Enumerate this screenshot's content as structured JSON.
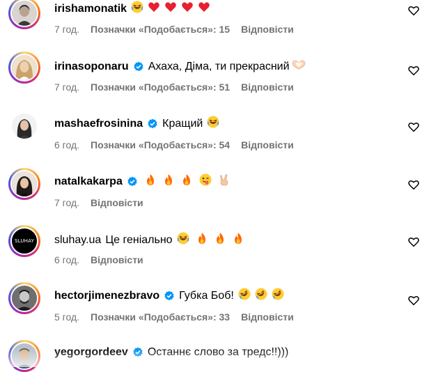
{
  "colors": {
    "verified_blue": "#0095f6",
    "meta_gray": "#737373",
    "heart_red": "#ff3040",
    "fire_orange": "#ff6a00"
  },
  "comments": [
    {
      "username": "irishamonatik",
      "verified": false,
      "text": "",
      "emojis": [
        "laughing-face",
        "red-heart",
        "red-heart",
        "red-heart",
        "red-heart"
      ],
      "time": "7 год.",
      "likes": "Позначки «Подобається»: 15",
      "reply": "Відповісти"
    },
    {
      "username": "irinasoponaru",
      "verified": true,
      "text": "Ахаха, Діма, ти прекрасний",
      "emojis": [
        "heart-hands"
      ],
      "time": "7 год.",
      "likes": "Позначки «Подобається»: 51",
      "reply": "Відповісти"
    },
    {
      "username": "mashaefrosinina",
      "verified": true,
      "text": "Кращий",
      "emojis": [
        "laughing-face"
      ],
      "time": "6 год.",
      "likes": "Позначки «Подобається»: 54",
      "reply": "Відповісти"
    },
    {
      "username": "natalkakarpa",
      "verified": true,
      "text": "",
      "emojis": [
        "fire",
        "fire",
        "fire",
        "winking-tongue-face",
        "victory-hand"
      ],
      "time": "7 год.",
      "likes": "",
      "reply": "Відповісти"
    },
    {
      "username": "sluhay.ua",
      "verified": false,
      "text": "Це геніально",
      "emojis": [
        "laughing-face",
        "fire",
        "fire",
        "fire"
      ],
      "time": "6 год.",
      "likes": "",
      "reply": "Відповісти",
      "avatar_label": "SLUHAY"
    },
    {
      "username": "hectorjimenezbravo",
      "verified": true,
      "text": "Губка Боб!",
      "emojis": [
        "rolling-laugh-face",
        "rolling-laugh-face",
        "rolling-laugh-face"
      ],
      "time": "5 год.",
      "likes": "Позначки «Подобається»: 33",
      "reply": "Відповісти"
    },
    {
      "username": "yegorgordeev",
      "verified": true,
      "text": "Останнє слово за тредс!!)))",
      "emojis": [],
      "time": "",
      "likes": "",
      "reply": ""
    }
  ]
}
